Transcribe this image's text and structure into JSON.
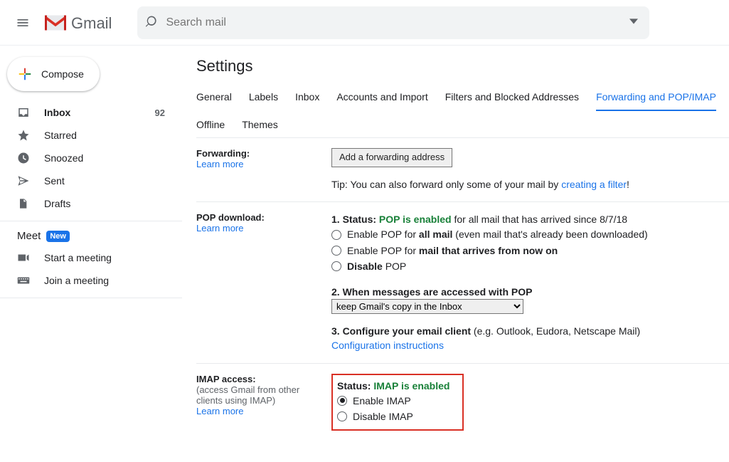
{
  "app": {
    "name": "Gmail",
    "search_placeholder": "Search mail"
  },
  "compose_label": "Compose",
  "sidebar": {
    "items": [
      {
        "name": "inbox",
        "label": "Inbox",
        "icon": "inbox-icon",
        "count": "92",
        "bold": true
      },
      {
        "name": "starred",
        "label": "Starred",
        "icon": "star-icon"
      },
      {
        "name": "snoozed",
        "label": "Snoozed",
        "icon": "clock-icon"
      },
      {
        "name": "sent",
        "label": "Sent",
        "icon": "send-icon"
      },
      {
        "name": "drafts",
        "label": "Drafts",
        "icon": "file-icon"
      }
    ],
    "meet": {
      "title": "Meet",
      "badge": "New",
      "items": [
        {
          "name": "start-meeting",
          "label": "Start a meeting",
          "icon": "video-icon"
        },
        {
          "name": "join-meeting",
          "label": "Join a meeting",
          "icon": "keyboard-icon"
        }
      ]
    }
  },
  "settings": {
    "title": "Settings",
    "tabs": [
      {
        "id": "general",
        "label": "General"
      },
      {
        "id": "labels",
        "label": "Labels"
      },
      {
        "id": "inbox",
        "label": "Inbox"
      },
      {
        "id": "accounts",
        "label": "Accounts and Import"
      },
      {
        "id": "filters",
        "label": "Filters and Blocked Addresses"
      },
      {
        "id": "forwarding",
        "label": "Forwarding and POP/IMAP",
        "active": true
      },
      {
        "id": "offline",
        "label": "Offline"
      },
      {
        "id": "themes",
        "label": "Themes"
      }
    ],
    "forwarding": {
      "title": "Forwarding:",
      "learn_more": "Learn more",
      "add_btn": "Add a forwarding address",
      "tip_pre": "Tip: You can also forward only some of your mail by ",
      "tip_link": "creating a filter",
      "tip_post": "!"
    },
    "pop": {
      "title": "POP download:",
      "learn_more": "Learn more",
      "l1a": "1. Status: ",
      "l1b": "POP is enabled",
      "l1c": " for all mail that has arrived since 8/7/18",
      "r1a": "Enable POP for ",
      "r1b": "all mail",
      "r1c": " (even mail that's already been downloaded)",
      "r2a": "Enable POP for ",
      "r2b": "mail that arrives from now on",
      "r3a": "Disable",
      "r3b": " POP",
      "l2": "2. When messages are accessed with POP",
      "select_value": "keep Gmail's copy in the Inbox",
      "l3a": "3. Configure your email client",
      "l3b": " (e.g. Outlook, Eudora, Netscape Mail)",
      "l3link": "Configuration instructions"
    },
    "imap": {
      "title": "IMAP access:",
      "sub": "(access Gmail from other clients using IMAP)",
      "learn_more": "Learn more",
      "status_pre": "Status: ",
      "status_val": "IMAP is enabled",
      "r1": "Enable IMAP",
      "r2": "Disable IMAP"
    }
  }
}
